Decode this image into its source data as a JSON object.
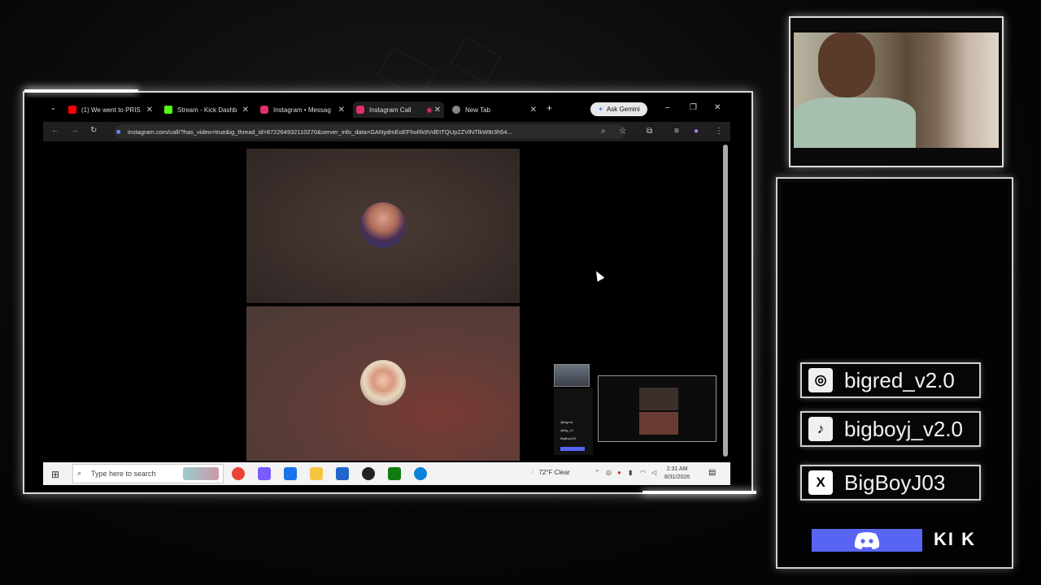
{
  "browser": {
    "tabs": [
      {
        "label": "(1) We went to PRIS",
        "color": "#ff0000"
      },
      {
        "label": "Stream - Kick Dashb",
        "color": "#53fc18"
      },
      {
        "label": "Instagram • Messag",
        "color": "#e1306c"
      },
      {
        "label": "Instagram Call",
        "color": "#e1306c"
      },
      {
        "label": "New Tab",
        "color": "#888888"
      }
    ],
    "gemini_label": "Ask Gemini",
    "url": "instagram.com/call/?has_video=true&ig_thread_id=872264932110270&server_info_data=GANydmEoEFhoRk9VdEtTQUp2ZVlNTlkW8r3h54...",
    "minimize": "–",
    "restore": "❐",
    "close": "✕",
    "new_tab": "+"
  },
  "taskbar": {
    "search_placeholder": "Type here to search",
    "weather": "72°F  Clear",
    "time": "2:31 AM",
    "date": "8/31/2026"
  },
  "mini_panel": {
    "rows": [
      "@bigred",
      "@big_v2",
      "BigBoyJ03"
    ]
  },
  "socials": [
    {
      "icon": "instagram-icon",
      "glyph": "◎",
      "handle": "bigred_v2.0"
    },
    {
      "icon": "tiktok-icon",
      "glyph": "♪",
      "handle": "bigboyj_v2.0"
    },
    {
      "icon": "x-icon",
      "glyph": "X",
      "handle": "BigBoyJ03"
    }
  ],
  "kick_label": "KI K",
  "colors": {
    "discord": "#5865f2",
    "accent": "#5b8dff"
  }
}
